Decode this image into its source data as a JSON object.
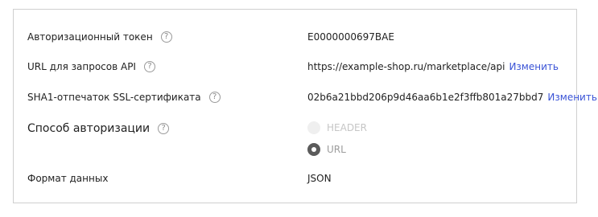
{
  "rows": [
    {
      "label": "Авторизационный токен",
      "value": "E0000000697BAE",
      "link": ""
    },
    {
      "label": "URL для запросов API",
      "value": "https://example-shop.ru/marketplace/api",
      "link": "Изменить"
    },
    {
      "label": "SHA1-отпечаток SSL-сертификата",
      "value": "02b6a21bbd206p9d46aa6b1e2f3ffb801a27bbd7",
      "link": "Изменить"
    }
  ],
  "auth": {
    "label": "Способ авторизации",
    "options": [
      {
        "label": "HEADER",
        "selected": false,
        "disabled": true
      },
      {
        "label": "URL",
        "selected": true,
        "disabled": false
      }
    ]
  },
  "format": {
    "label": "Формат данных",
    "value": "JSON"
  },
  "help_glyph": "?",
  "icons": {
    "help": "question-circle-icon"
  }
}
